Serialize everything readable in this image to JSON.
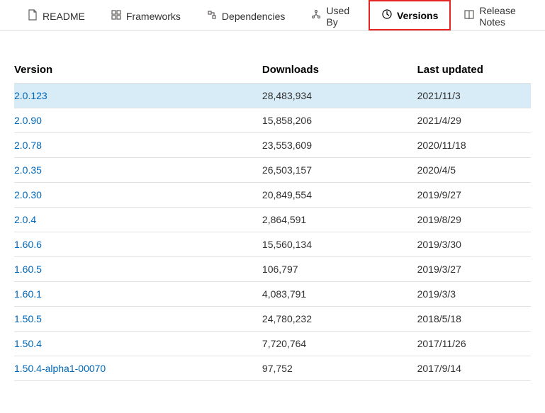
{
  "tabs": [
    {
      "label": "README"
    },
    {
      "label": "Frameworks"
    },
    {
      "label": "Dependencies"
    },
    {
      "label": "Used By"
    },
    {
      "label": "Versions",
      "active": true
    },
    {
      "label": "Release Notes"
    }
  ],
  "table": {
    "headers": {
      "version": "Version",
      "downloads": "Downloads",
      "last_updated": "Last updated"
    },
    "rows": [
      {
        "version": "2.0.123",
        "downloads": "28,483,934",
        "last_updated": "2021/11/3",
        "highlight": true
      },
      {
        "version": "2.0.90",
        "downloads": "15,858,206",
        "last_updated": "2021/4/29"
      },
      {
        "version": "2.0.78",
        "downloads": "23,553,609",
        "last_updated": "2020/11/18"
      },
      {
        "version": "2.0.35",
        "downloads": "26,503,157",
        "last_updated": "2020/4/5"
      },
      {
        "version": "2.0.30",
        "downloads": "20,849,554",
        "last_updated": "2019/9/27"
      },
      {
        "version": "2.0.4",
        "downloads": "2,864,591",
        "last_updated": "2019/8/29"
      },
      {
        "version": "1.60.6",
        "downloads": "15,560,134",
        "last_updated": "2019/3/30"
      },
      {
        "version": "1.60.5",
        "downloads": "106,797",
        "last_updated": "2019/3/27"
      },
      {
        "version": "1.60.1",
        "downloads": "4,083,791",
        "last_updated": "2019/3/3"
      },
      {
        "version": "1.50.5",
        "downloads": "24,780,232",
        "last_updated": "2018/5/18"
      },
      {
        "version": "1.50.4",
        "downloads": "7,720,764",
        "last_updated": "2017/11/26"
      },
      {
        "version": "1.50.4-alpha1-00070",
        "downloads": "97,752",
        "last_updated": "2017/9/14"
      }
    ]
  }
}
